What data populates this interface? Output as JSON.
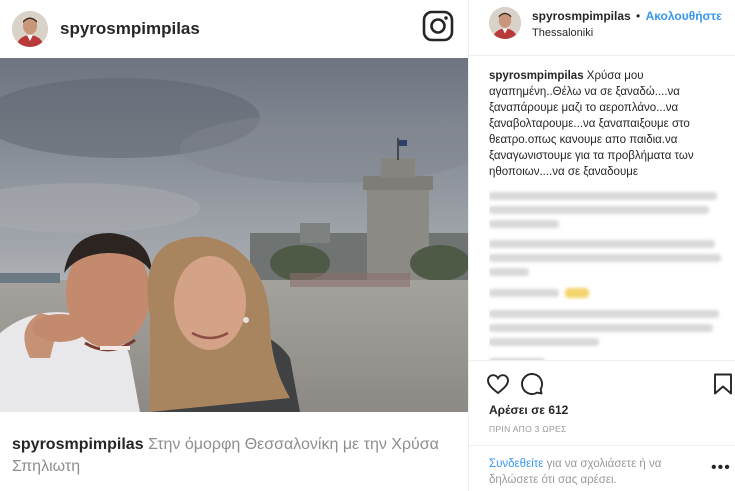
{
  "left": {
    "username": "spyrosmpimpilas",
    "caption_user": "spyrosmpimpilas",
    "caption_text": "Στην όμορφη Θεσσαλονίκη με την Χρύσα Σπηλιωτη"
  },
  "right": {
    "username": "spyrosmpimpilas",
    "dot": "•",
    "follow_label": "Ακολουθήστε",
    "location": "Thessaloniki",
    "comment_user": "spyrosmpimpilas",
    "comment_text": "Χρύσα μου αγαπημένη..Θέλω να σε ξαναδώ....να ξαναπάρουμε μαζι το αεροπλάνο...να ξαναβολταρουμε...να ξαναπαιξουμε στο θεατρο.οπως κανουμε απο παιδια.να ξαναγωνιστουμε για τα προβλήματα των ηθοποιων....να σε ξαναδουμε",
    "likes": "Αρέσει σε 612",
    "time": "ΠΡΙΝ ΑΠΟ 3 ΩΡΕΣ",
    "login_link": "Συνδεθείτε",
    "login_text": " για να σχολιάσετε ή να δηλώσετε ότι σας αρέσει.",
    "more": "•••"
  },
  "icons": {
    "instagram": "instagram-glyph-icon",
    "heart": "heart-icon",
    "comment": "comment-icon",
    "save": "bookmark-icon",
    "more": "more-options-icon"
  },
  "colors": {
    "link_blue": "#3897f0",
    "text": "#262626",
    "muted": "#999999"
  }
}
